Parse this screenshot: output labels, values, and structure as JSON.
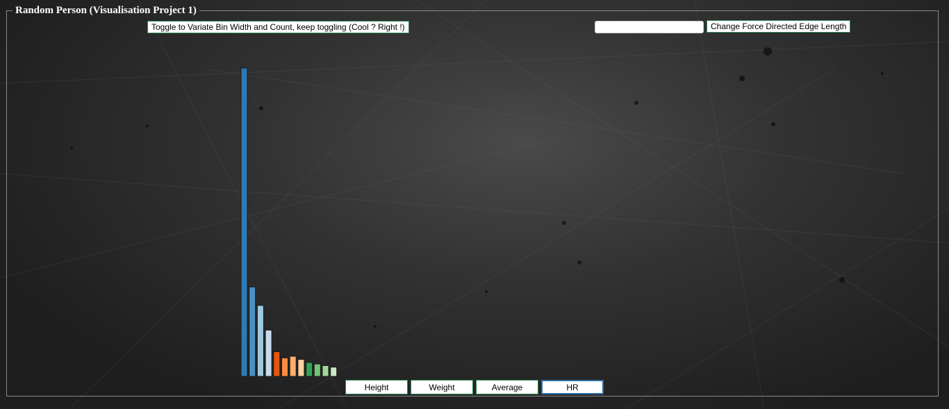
{
  "window": {
    "title": "Random Person (Visualisation Project 1)"
  },
  "toolbar": {
    "toggle_label": "Toggle to Variate Bin Width and Count, keep toggling (Cool ? Right !)",
    "edge_input_value": "",
    "edge_button_label": "Change Force Directed Edge Length"
  },
  "tabs": [
    {
      "label": "Height",
      "active": false
    },
    {
      "label": "Weight",
      "active": false
    },
    {
      "label": "Average",
      "active": false
    },
    {
      "label": "HR",
      "active": true
    }
  ],
  "chart_data": {
    "type": "bar",
    "title": "",
    "xlabel": "",
    "ylabel": "",
    "axes_visible": false,
    "grid": false,
    "ylim": [
      0,
      100
    ],
    "values": [
      100,
      29,
      23,
      15,
      8,
      6,
      6.5,
      5.5,
      4.5,
      4,
      3.5,
      3
    ],
    "colors": [
      "#2c7bb6",
      "#4a90c4",
      "#9ecae1",
      "#c6dbef",
      "#e6550d",
      "#fd8d3c",
      "#fdae6b",
      "#fdd0a2",
      "#31a354",
      "#74c476",
      "#a1d99b",
      "#c7e9c0"
    ]
  }
}
